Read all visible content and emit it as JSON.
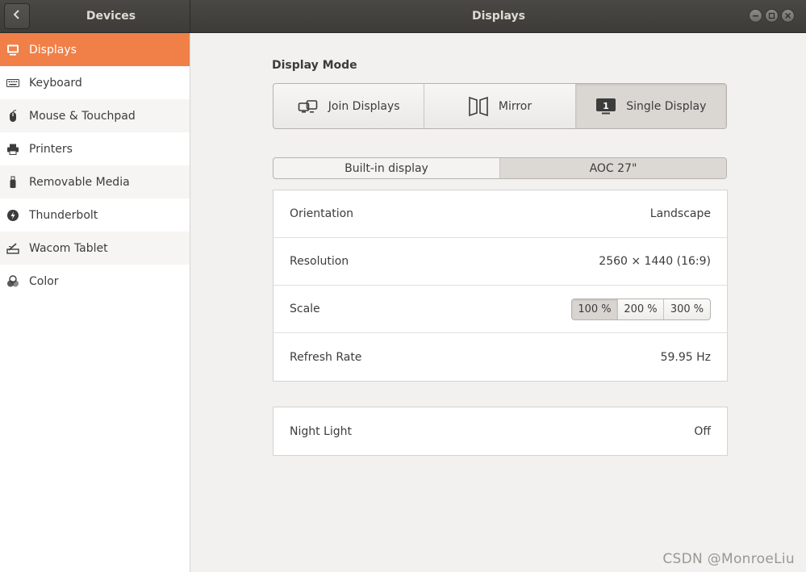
{
  "header": {
    "left_title": "Devices",
    "title": "Displays",
    "back_icon": "chevron-left-icon",
    "window_buttons": [
      "minimize-icon",
      "maximize-icon",
      "close-icon"
    ]
  },
  "sidebar": {
    "items": [
      {
        "label": "Displays",
        "icon": "display-icon"
      },
      {
        "label": "Keyboard",
        "icon": "keyboard-icon"
      },
      {
        "label": "Mouse & Touchpad",
        "icon": "mouse-icon"
      },
      {
        "label": "Printers",
        "icon": "printer-icon"
      },
      {
        "label": "Removable Media",
        "icon": "usb-drive-icon"
      },
      {
        "label": "Thunderbolt",
        "icon": "thunderbolt-icon"
      },
      {
        "label": "Wacom Tablet",
        "icon": "tablet-icon"
      },
      {
        "label": "Color",
        "icon": "color-icon"
      }
    ],
    "active_index": 0,
    "accent_color": "#f08048"
  },
  "display_mode": {
    "title": "Display Mode",
    "options": [
      {
        "label": "Join Displays",
        "icon": "join-displays-icon"
      },
      {
        "label": "Mirror",
        "icon": "mirror-icon"
      },
      {
        "label": "Single Display",
        "icon": "single-display-icon"
      }
    ],
    "selected_index": 2
  },
  "display_tabs": {
    "tabs": [
      "Built-in display",
      "AOC 27\""
    ],
    "active_index": 1
  },
  "settings": {
    "orientation": {
      "label": "Orientation",
      "value": "Landscape"
    },
    "resolution": {
      "label": "Resolution",
      "value": "2560 × 1440 (16:9)"
    },
    "scale": {
      "label": "Scale",
      "options": [
        "100 %",
        "200 %",
        "300 %"
      ],
      "selected_index": 0
    },
    "refresh_rate": {
      "label": "Refresh Rate",
      "value": "59.95 Hz"
    }
  },
  "night_light": {
    "label": "Night Light",
    "value": "Off"
  },
  "watermark": "CSDN @MonroeLiu"
}
